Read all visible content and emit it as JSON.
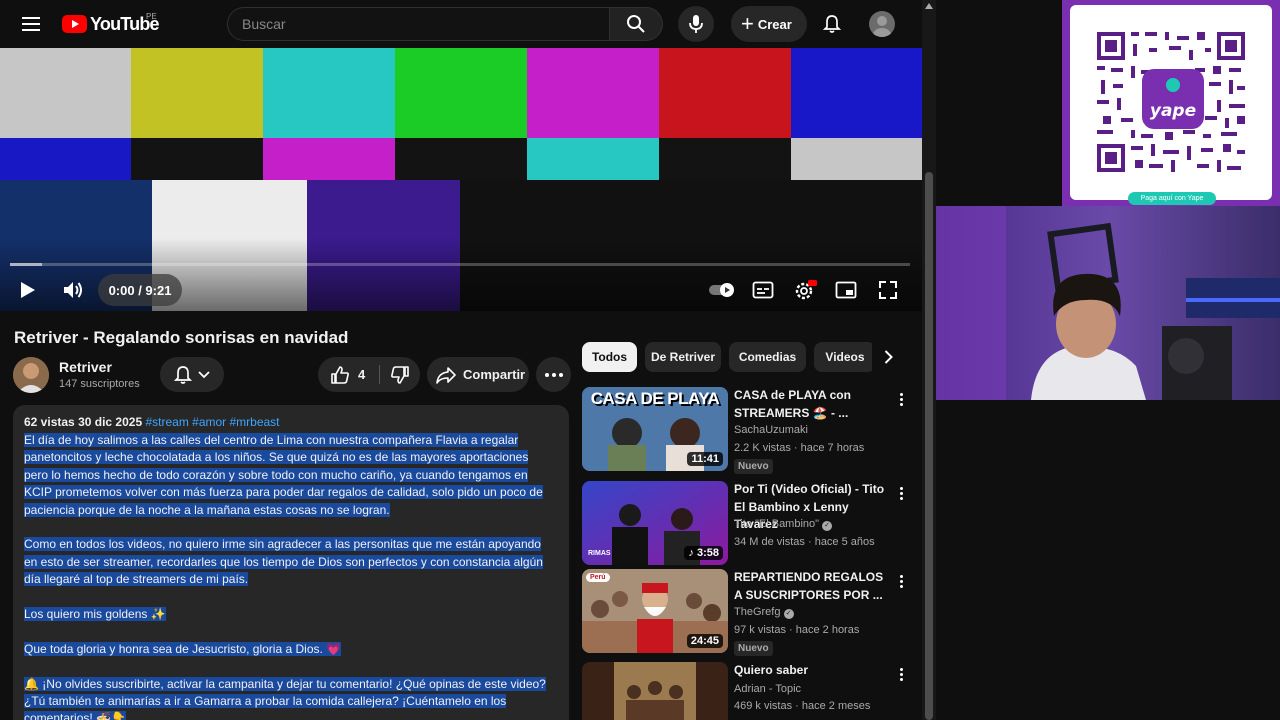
{
  "header": {
    "logo_text": "YouTube",
    "country_code": "PE",
    "search_placeholder": "Buscar",
    "create_label": "Crear"
  },
  "player": {
    "time": "0:00 / 9:21",
    "progress_loaded_fraction": 0.036
  },
  "video": {
    "title": "Retriver - Regalando sonrisas en navidad",
    "channel_name": "Retriver",
    "subscribers": "147 suscriptores",
    "likes": "4",
    "share_label": "Compartir",
    "views": "62 vistas",
    "date": "30 dic 2025",
    "hashtags": "#stream #amor #mrbeast",
    "description": {
      "p1_l1": "El día de hoy salimos a las calles del centro de Lima con nuestra compañera Flavia a regalar",
      "p1_l2": "panetoncitos y leche chocolatada a los niños. Se que quizá no es de las mayores aportaciones",
      "p1_l3": "pero lo hemos hecho de todo corazón y sobre todo con mucho cariño, ya cuando tengamos en",
      "p1_l4": "KCIP prometemos volver con más fuerza para poder dar regalos de calidad, solo pido  un poco de",
      "p1_l5": "paciencia porque de la noche a la mañana estas cosas no se logran.",
      "p2_l1": "Como en todos los videos, no quiero irme sin agradecer a las personitas que me están apoyando",
      "p2_l2": "en esto de ser streamer, recordarles que los tiempo de Dios son perfectos y con constancia algún",
      "p2_l3": "día llegaré al top de streamers de mi país.",
      "p3": "Los quiero mis goldens ✨",
      "p4": "Que toda gloria y honra sea de Jesucristo, gloria a Dios. 💗",
      "p5_l1": "🔔 ¡No olvides suscribirte, activar la campanita y dejar tu comentario! ¿Qué opinas de este video?",
      "p5_l2": "¿Tú también te animarías a ir a Gamarra a probar la comida callejera? ¡Cuéntamelo en los",
      "p5_l3": "comentarios! 🍜👇"
    }
  },
  "chips": [
    "Todos",
    "De Retriver",
    "Comedias",
    "Videos"
  ],
  "recommendations": [
    {
      "title": "CASA de PLAYA con STREAMERS 🏖️ - ...",
      "channel": "SachaUzumaki",
      "meta": "2.2 K vistas · hace 7 horas",
      "badge": "Nuevo",
      "duration": "11:41",
      "thumb_text": "CASA DE PLAYA"
    },
    {
      "title": "Por Ti (Video Oficial) - Tito El Bambino x Lenny Tavarez",
      "channel": "Tito \"El Bambino\"",
      "meta": "34 M de vistas · hace 5 años",
      "duration": "3:58",
      "thumb_text": "RIMAS"
    },
    {
      "title": "REPARTIENDO REGALOS A SUSCRIPTORES POR ...",
      "channel": "TheGrefg",
      "meta": "97 k vistas · hace 2 horas",
      "badge": "Nuevo",
      "duration": "24:45",
      "thumb_text": "Perú"
    },
    {
      "title": "Quiero saber",
      "channel": "Adrian - Topic",
      "meta": "469 k vistas · hace 2 meses"
    }
  ],
  "overlay": {
    "qr_caption": "Paga aquí con Yape",
    "qr_logo_text": "yape"
  },
  "colors": {
    "background": "#0f0f0f",
    "surface": "#272727",
    "brand_red": "#ff0000",
    "link_blue": "#3ea6ff",
    "selection": "#1a4a9e",
    "yape_purple": "#7a2fb0"
  }
}
